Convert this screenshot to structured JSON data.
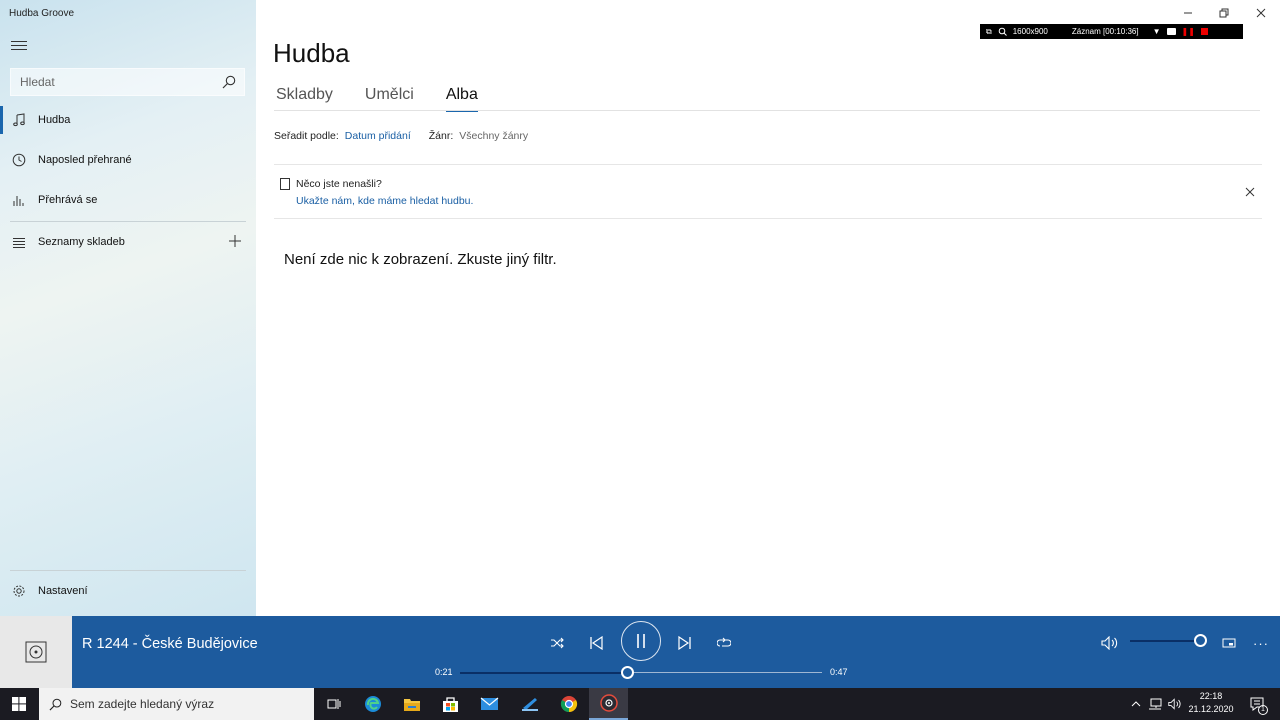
{
  "window": {
    "app_title": "Hudba Groove"
  },
  "recorder": {
    "resolution": "1600x900",
    "status": "Záznam [00:10:36]"
  },
  "sidebar": {
    "search_placeholder": "Hledat",
    "items": [
      {
        "label": "Hudba",
        "icon": "music-note-icon"
      },
      {
        "label": "Naposled přehrané",
        "icon": "clock-icon"
      },
      {
        "label": "Přehrává se",
        "icon": "equalizer-icon"
      },
      {
        "label": "Seznamy skladeb",
        "icon": "playlist-icon"
      }
    ],
    "settings_label": "Nastavení"
  },
  "main": {
    "title": "Hudba",
    "tabs": [
      {
        "label": "Skladby"
      },
      {
        "label": "Umělci"
      },
      {
        "label": "Alba"
      }
    ],
    "sort_label": "Seřadit podle:",
    "sort_value": "Datum přidání",
    "genre_label": "Žánr:",
    "genre_value": "Všechny žánry",
    "notice_title": "Něco jste nenašli?",
    "notice_link": "Ukažte nám, kde máme hledat hudbu.",
    "empty_message": "Není zde nic k zobrazení. Zkuste jiný filtr."
  },
  "player": {
    "track_title": "R 1244 - České Budějovice",
    "elapsed": "0:21",
    "remaining": "0:47",
    "progress_fraction": 0.46,
    "volume_fraction": 1.0
  },
  "taskbar": {
    "search_placeholder": "Sem zadejte hledaný výraz",
    "time": "22:18",
    "date": "21.12.2020",
    "notification_count": "1",
    "colors": {
      "taskbar_bg": "#1b1b22",
      "player_bg": "#1d5b9e",
      "accent": "#1a66ad"
    }
  }
}
